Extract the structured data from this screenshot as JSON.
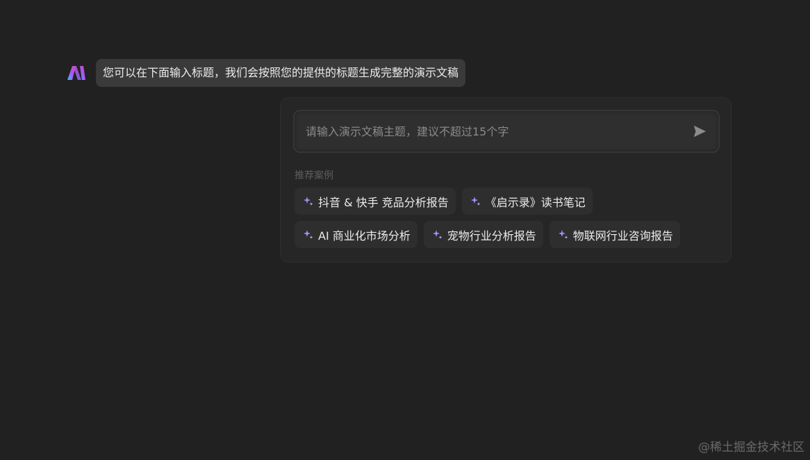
{
  "assistant": {
    "logo_icon": "gradient-n-logo-icon",
    "message": "您可以在下面输入标题，我们会按照您的提供的标题生成完整的演示文稿"
  },
  "prompt_card": {
    "input": {
      "value": "",
      "placeholder": "请输入演示文稿主题，建议不超过15个字"
    },
    "send_icon": "send-arrow-icon",
    "section_label": "推荐案例",
    "examples_rows": [
      [
        "抖音 & 快手 竞品分析报告",
        "《启示录》读书笔记"
      ],
      [
        "AI 商业化市场分析",
        "宠物行业分析报告",
        "物联网行业咨询报告"
      ]
    ],
    "example_icon": "sparkle-icon"
  },
  "watermark": "@稀土掘金技术社区",
  "colors": {
    "background": "#212121",
    "bubble": "#3a3a3a",
    "card": "#262626",
    "chip": "#2e2e2e",
    "sparkle": "#a78bfa",
    "logo_gradient": [
      "#60a5fa",
      "#a855f7",
      "#ec4899"
    ]
  }
}
